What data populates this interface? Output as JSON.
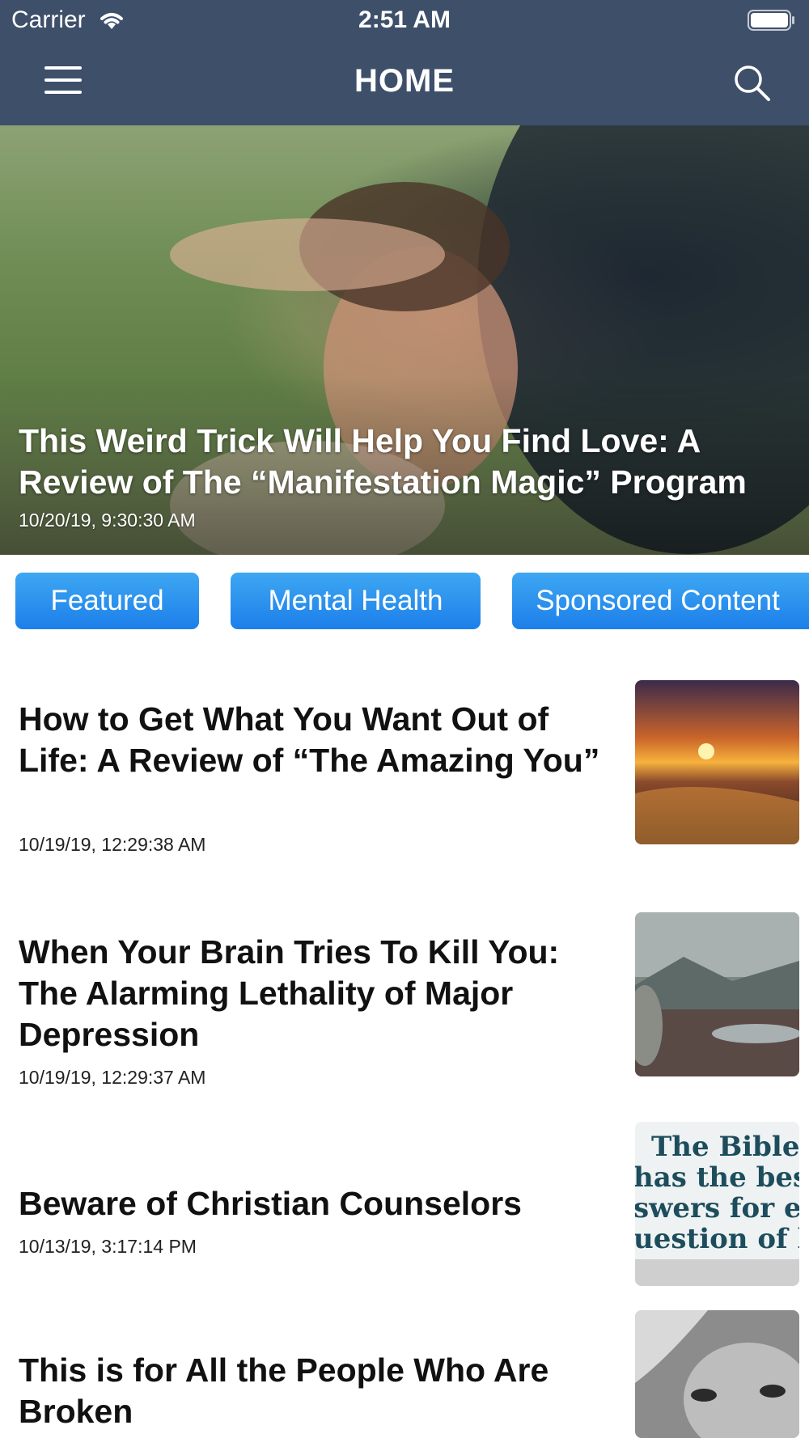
{
  "status": {
    "carrier": "Carrier",
    "time": "2:51 AM"
  },
  "nav": {
    "title": "HOME",
    "menu_icon": "hamburger-menu-icon",
    "search_icon": "search-icon"
  },
  "hero": {
    "title": "This Weird Trick Will Help You Find Love: A Review of The “Manifestation Magic” Program",
    "date": "10/20/19, 9:30:30 AM"
  },
  "categories": [
    {
      "label": "Featured"
    },
    {
      "label": "Mental Health"
    },
    {
      "label": "Sponsored Content"
    }
  ],
  "articles": [
    {
      "title": "How to Get What You Want Out of Life: A Review of “The Amazing You”",
      "date": "10/19/19, 12:29:38 AM"
    },
    {
      "title": "When Your Brain Tries To Kill You: The Alarming Lethality of Major Depression",
      "date": "10/19/19, 12:29:37 AM"
    },
    {
      "title": "Beware of Christian Counselors",
      "date": "10/13/19, 3:17:14 PM",
      "thumb_text": [
        "The Bible",
        "has the best",
        "swers for ev",
        "uestion of li"
      ]
    },
    {
      "title": "This is for All the People Who Are Broken",
      "date": ""
    }
  ],
  "colors": {
    "nav_bg": "#3e4f6a",
    "pill_bg": "#2a90ee",
    "text": "#111111"
  }
}
